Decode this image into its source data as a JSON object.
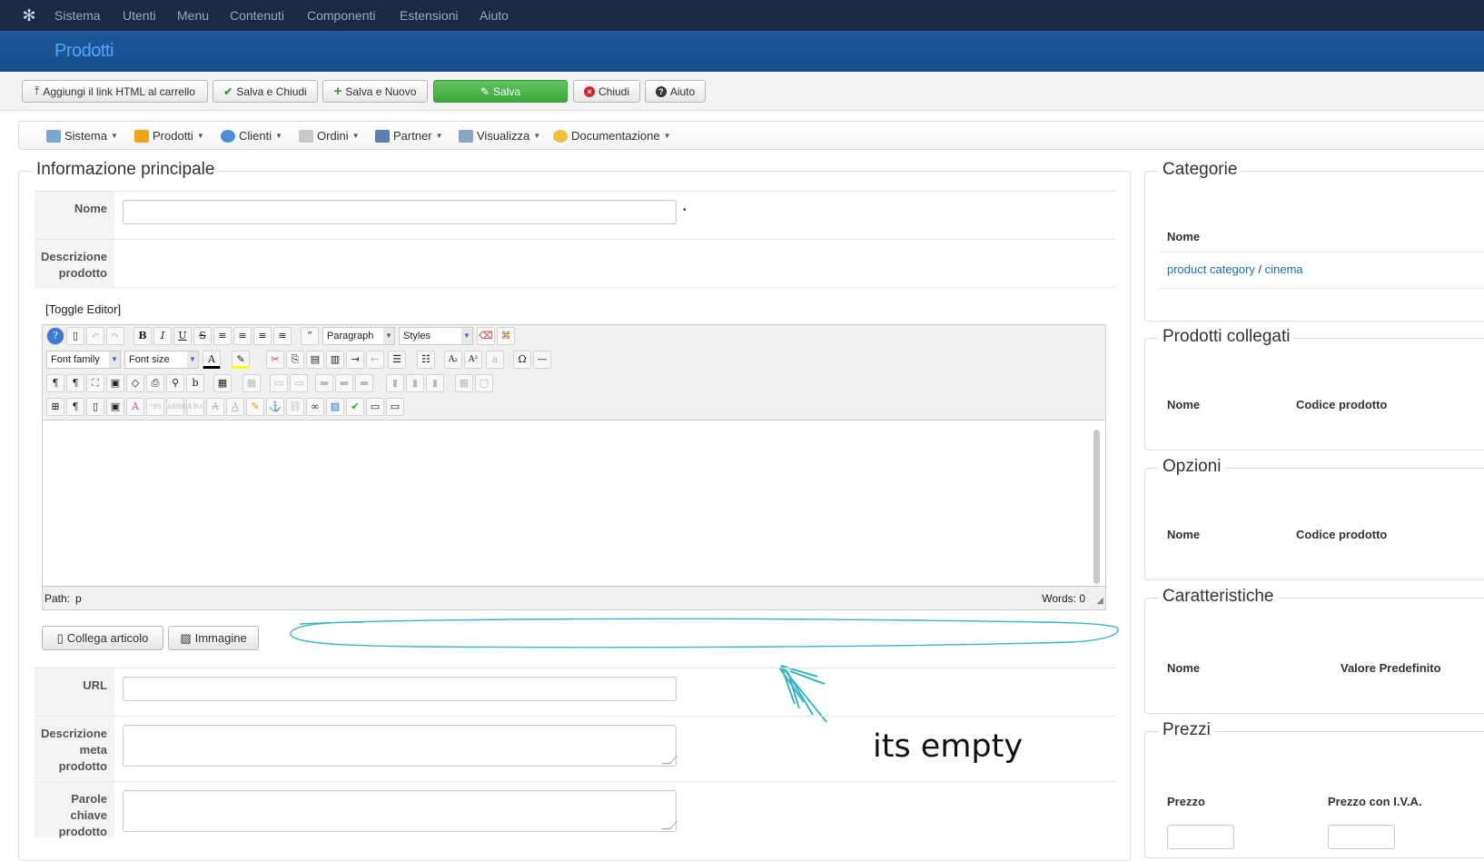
{
  "topnav": {
    "items": [
      "Sistema",
      "Utenti",
      "Menu",
      "Contenuti",
      "Componenti",
      "Estensioni",
      "Aiuto"
    ]
  },
  "header": {
    "title": "Prodotti"
  },
  "toolbar": {
    "add_html_link": "Aggiungi il link HTML al carrello",
    "save_close": "Salva e Chiudi",
    "save_new": "Salva e Nuovo",
    "save": "Salva",
    "close": "Chiudi",
    "help": "Aiuto"
  },
  "menubar": {
    "items": [
      "Sistema",
      "Prodotti",
      "Clienti",
      "Ordini",
      "Partner",
      "Visualizza",
      "Documentazione"
    ]
  },
  "main": {
    "legend": "Informazione principale",
    "name_label": "Nome",
    "desc_label_1": "Descrizione",
    "desc_label_2": "prodotto",
    "required_mark": "•",
    "toggle_editor": "[Toggle Editor]",
    "editor": {
      "format_select": "Paragraph",
      "styles_select": "Styles",
      "font_family_select": "Font family",
      "font_size_select": "Font size",
      "path_label": "Path:",
      "path_value": "p",
      "words_label": "Words: 0"
    },
    "link_article_button": "Collega articolo",
    "image_button": "Immagine",
    "url_label": "URL",
    "meta_desc_label_1": "Descrizione",
    "meta_desc_label_2": "meta",
    "meta_desc_label_3": "prodotto",
    "keywords_label_1": "Parole",
    "keywords_label_2": "chiave",
    "keywords_label_3": "prodotto",
    "annotation": "its empty"
  },
  "sidebar": {
    "categories": {
      "legend": "Categorie",
      "col_name": "Nome",
      "cat_parent": "product category",
      "cat_sep": "/",
      "cat_child": "cinema"
    },
    "related": {
      "legend": "Prodotti collegati",
      "col_name": "Nome",
      "col_code": "Codice prodotto"
    },
    "options": {
      "legend": "Opzioni",
      "col_name": "Nome",
      "col_code": "Codice prodotto"
    },
    "features": {
      "legend": "Caratteristiche",
      "col_name": "Nome",
      "col_default": "Valore Predefinito"
    },
    "prices": {
      "legend": "Prezzi",
      "col_price": "Prezzo",
      "col_price_vat": "Prezzo con I.V.A."
    }
  },
  "colors": {
    "nav_bg": "#1b2a44",
    "header_bg": "#1e5799",
    "title": "#4ea5ff",
    "save_green": "#51b751",
    "annotation": "#3ab5c8"
  }
}
